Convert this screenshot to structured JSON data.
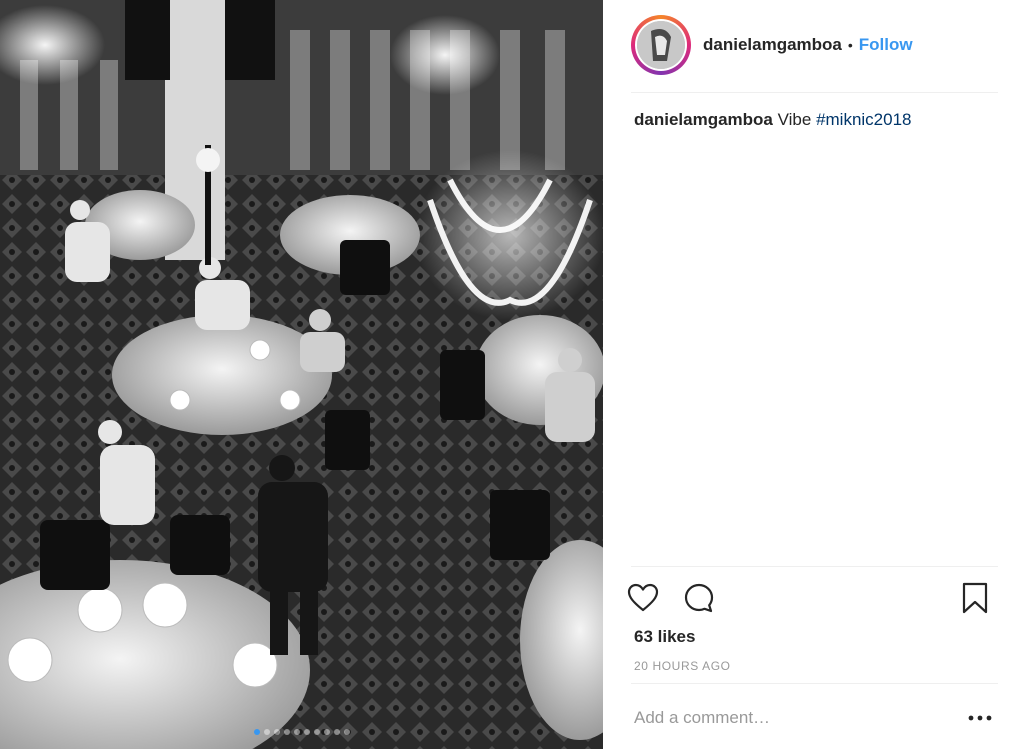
{
  "post": {
    "username": "danielamgamboa",
    "separator": "•",
    "follow_label": "Follow",
    "caption": {
      "username": "danielamgamboa",
      "text": "Vibe",
      "hashtag": "#miknic2018"
    },
    "likes": "63 likes",
    "timestamp": "20 HOURS AGO",
    "comment_placeholder": "Add a comment…",
    "more_label": "•••",
    "media_description": "black and white photo of a banquet hall with round dining tables and chandeliers",
    "carousel": {
      "count": 10,
      "active_index": 0
    }
  },
  "icons": {
    "like": "heart-outline-icon",
    "comment": "speech-bubble-icon",
    "save": "bookmark-outline-icon",
    "more": "ellipsis-icon"
  },
  "colors": {
    "accent": "#3897f0",
    "hashtag": "#003569",
    "muted": "#999999",
    "text": "#262626"
  }
}
